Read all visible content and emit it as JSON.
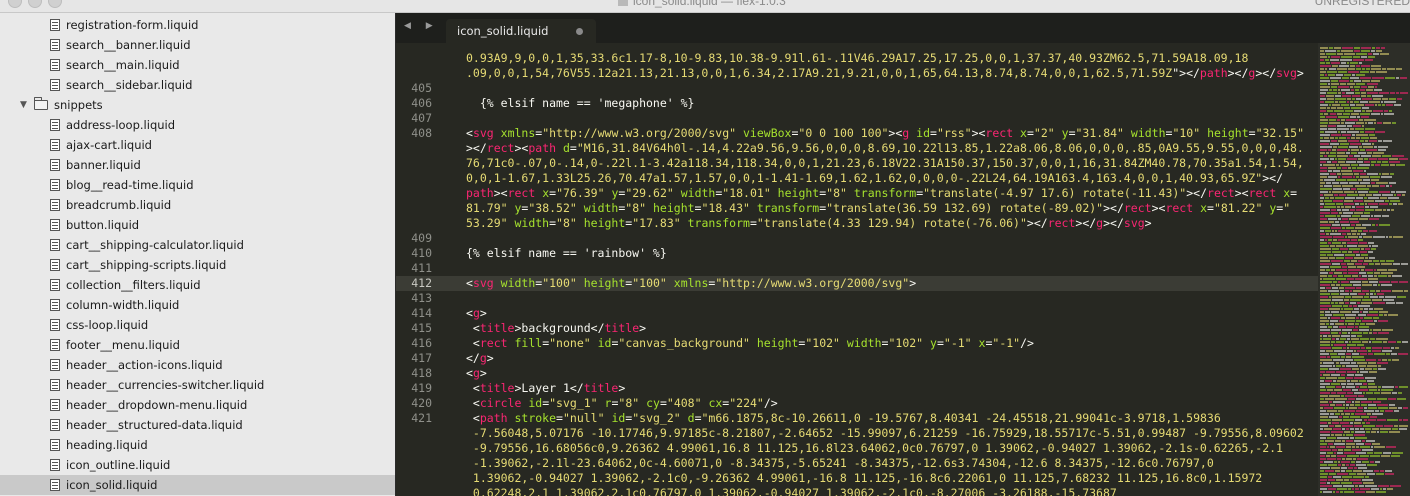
{
  "window": {
    "title": "icon_solid.liquid — flex-1.0.3",
    "license": "UNREGISTERED"
  },
  "sidebar": {
    "files_before": [
      "registration-form.liquid",
      "search__banner.liquid",
      "search__main.liquid",
      "search__sidebar.liquid"
    ],
    "folder": "snippets",
    "files": [
      "address-loop.liquid",
      "ajax-cart.liquid",
      "banner.liquid",
      "blog__read-time.liquid",
      "breadcrumb.liquid",
      "button.liquid",
      "cart__shipping-calculator.liquid",
      "cart__shipping-scripts.liquid",
      "collection__filters.liquid",
      "column-width.liquid",
      "css-loop.liquid",
      "footer__menu.liquid",
      "header__action-icons.liquid",
      "header__currencies-switcher.liquid",
      "header__dropdown-menu.liquid",
      "header__structured-data.liquid",
      "heading.liquid",
      "icon_outline.liquid",
      "icon_solid.liquid"
    ],
    "selected": "icon_solid.liquid"
  },
  "editor": {
    "tab_label": "icon_solid.liquid",
    "active_line": "412",
    "lines": [
      {
        "n": "",
        "segs": [
          [
            "s",
            "0.93A9,9,0,0,1,35,33.6c1.17-8,10-9.83,10.38-9.91l.61-.11V46.29A17.25,17.25,0,0,1,37.37,40.93ZM62.5,71.59A18.09,18"
          ]
        ]
      },
      {
        "n": "",
        "segs": [
          [
            "s",
            ".09,0,0,1,54,76V55.12a21.13,21.13,0,0,1,6.34,2.17A9.21,9.21,0,0,1,65,64.13,8.74,8.74,0,0,1,62.5,71.59Z"
          ],
          [
            "p",
            "\"></"
          ],
          [
            "t",
            "path"
          ],
          [
            "p",
            "></"
          ],
          [
            "t",
            "g"
          ],
          [
            "p",
            "></"
          ],
          [
            "t",
            "svg"
          ],
          [
            "p",
            ">"
          ]
        ]
      },
      {
        "n": "405",
        "segs": []
      },
      {
        "n": "406",
        "segs": [
          [
            "p",
            "  {% elsif name == 'megaphone' %}"
          ]
        ]
      },
      {
        "n": "407",
        "segs": []
      },
      {
        "n": "408",
        "segs": [
          [
            "p",
            "<"
          ],
          [
            "t",
            "svg"
          ],
          [
            "a",
            " xmlns"
          ],
          [
            "p",
            "="
          ],
          [
            "s",
            "\"http://www.w3.org/2000/svg\""
          ],
          [
            "a",
            " viewBox"
          ],
          [
            "p",
            "="
          ],
          [
            "s",
            "\"0 0 100 100\""
          ],
          [
            "p",
            "><"
          ],
          [
            "t",
            "g"
          ],
          [
            "a",
            " id"
          ],
          [
            "p",
            "="
          ],
          [
            "s",
            "\"rss\""
          ],
          [
            "p",
            "><"
          ],
          [
            "t",
            "rect"
          ],
          [
            "a",
            " x"
          ],
          [
            "p",
            "="
          ],
          [
            "s",
            "\"2\""
          ],
          [
            "a",
            " y"
          ],
          [
            "p",
            "="
          ],
          [
            "s",
            "\"31.84\""
          ],
          [
            "a",
            " width"
          ],
          [
            "p",
            "="
          ],
          [
            "s",
            "\"10\""
          ],
          [
            "a",
            " height"
          ],
          [
            "p",
            "="
          ],
          [
            "s",
            "\"32.15\""
          ]
        ]
      },
      {
        "n": "",
        "segs": [
          [
            "p",
            "></"
          ],
          [
            "t",
            "rect"
          ],
          [
            "p",
            "><"
          ],
          [
            "t",
            "path"
          ],
          [
            "a",
            " d"
          ],
          [
            "p",
            "="
          ],
          [
            "s",
            "\"M16,31.84V64h0l-.14,4.22a9.56,9.56,0,0,0,8.69,10.22l13.85,1.22a8.06,8.06,0,0,0,.85,0A9.55,9.55,0,0,0,48."
          ]
        ]
      },
      {
        "n": "",
        "segs": [
          [
            "s",
            "76,71c0-.07,0-.14,0-.22l.1-3.42a118.34,118.34,0,0,1,21.23,6.18V22.31A150.37,150.37,0,0,1,16,31.84ZM40.78,70.35a1.54,1.54,"
          ]
        ]
      },
      {
        "n": "",
        "segs": [
          [
            "s",
            "0,0,1-1.67,1.33L25.26,70.47a1.57,1.57,0,0,1-1.41-1.69,1.62,1.62,0,0,0,0-.22L24,64.19A163.4,163.4,0,0,1,40.93,65.9Z\""
          ],
          [
            "p",
            "></"
          ]
        ]
      },
      {
        "n": "",
        "segs": [
          [
            "t",
            "path"
          ],
          [
            "p",
            "><"
          ],
          [
            "t",
            "rect"
          ],
          [
            "a",
            " x"
          ],
          [
            "p",
            "="
          ],
          [
            "s",
            "\"76.39\""
          ],
          [
            "a",
            " y"
          ],
          [
            "p",
            "="
          ],
          [
            "s",
            "\"29.62\""
          ],
          [
            "a",
            " width"
          ],
          [
            "p",
            "="
          ],
          [
            "s",
            "\"18.01\""
          ],
          [
            "a",
            " height"
          ],
          [
            "p",
            "="
          ],
          [
            "s",
            "\"8\""
          ],
          [
            "a",
            " transform"
          ],
          [
            "p",
            "="
          ],
          [
            "s",
            "\"translate(-4.97 17.6) rotate(-11.43)\""
          ],
          [
            "p",
            "></"
          ],
          [
            "t",
            "rect"
          ],
          [
            "p",
            "><"
          ],
          [
            "t",
            "rect"
          ],
          [
            "a",
            " x"
          ],
          [
            "p",
            "="
          ]
        ]
      },
      {
        "n": "",
        "segs": [
          [
            "s",
            "81.79\""
          ],
          [
            "a",
            " y"
          ],
          [
            "p",
            "="
          ],
          [
            "s",
            "\"38.52\""
          ],
          [
            "a",
            " width"
          ],
          [
            "p",
            "="
          ],
          [
            "s",
            "\"8\""
          ],
          [
            "a",
            " height"
          ],
          [
            "p",
            "="
          ],
          [
            "s",
            "\"18.43\""
          ],
          [
            "a",
            " transform"
          ],
          [
            "p",
            "="
          ],
          [
            "s",
            "\"translate(36.59 132.69) rotate(-89.02)\""
          ],
          [
            "p",
            "></"
          ],
          [
            "t",
            "rect"
          ],
          [
            "p",
            "><"
          ],
          [
            "t",
            "rect"
          ],
          [
            "a",
            " x"
          ],
          [
            "p",
            "="
          ],
          [
            "s",
            "\"81.22\""
          ],
          [
            "a",
            " y"
          ],
          [
            "p",
            "="
          ],
          [
            "s",
            "\""
          ]
        ]
      },
      {
        "n": "",
        "segs": [
          [
            "s",
            "53.29\""
          ],
          [
            "a",
            " width"
          ],
          [
            "p",
            "="
          ],
          [
            "s",
            "\"8\""
          ],
          [
            "a",
            " height"
          ],
          [
            "p",
            "="
          ],
          [
            "s",
            "\"17.83\""
          ],
          [
            "a",
            " transform"
          ],
          [
            "p",
            "="
          ],
          [
            "s",
            "\"translate(4.33 129.94) rotate(-76.06)\""
          ],
          [
            "p",
            "></"
          ],
          [
            "t",
            "rect"
          ],
          [
            "p",
            "></"
          ],
          [
            "t",
            "g"
          ],
          [
            "p",
            "></"
          ],
          [
            "t",
            "svg"
          ],
          [
            "p",
            ">"
          ]
        ]
      },
      {
        "n": "409",
        "segs": []
      },
      {
        "n": "410",
        "segs": [
          [
            "p",
            "{% elsif name == 'rainbow' %}"
          ]
        ]
      },
      {
        "n": "411",
        "segs": []
      },
      {
        "n": "412",
        "segs": [
          [
            "p",
            "<"
          ],
          [
            "t",
            "svg"
          ],
          [
            "a",
            " width"
          ],
          [
            "p",
            "="
          ],
          [
            "s",
            "\"100\""
          ],
          [
            "a",
            " height"
          ],
          [
            "p",
            "="
          ],
          [
            "s",
            "\"100\""
          ],
          [
            "a",
            " xmlns"
          ],
          [
            "p",
            "="
          ],
          [
            "s",
            "\"http://www.w3.org/2000/svg\""
          ],
          [
            "p",
            ">"
          ]
        ]
      },
      {
        "n": "413",
        "segs": []
      },
      {
        "n": "414",
        "segs": [
          [
            "p",
            "<"
          ],
          [
            "t",
            "g"
          ],
          [
            "p",
            ">"
          ]
        ]
      },
      {
        "n": "415",
        "segs": [
          [
            "p",
            " <"
          ],
          [
            "t",
            "title"
          ],
          [
            "p",
            ">background</"
          ],
          [
            "t",
            "title"
          ],
          [
            "p",
            ">"
          ]
        ]
      },
      {
        "n": "416",
        "segs": [
          [
            "p",
            " <"
          ],
          [
            "t",
            "rect"
          ],
          [
            "a",
            " fill"
          ],
          [
            "p",
            "="
          ],
          [
            "s",
            "\"none\""
          ],
          [
            "a",
            " id"
          ],
          [
            "p",
            "="
          ],
          [
            "s",
            "\"canvas_background\""
          ],
          [
            "a",
            " height"
          ],
          [
            "p",
            "="
          ],
          [
            "s",
            "\"102\""
          ],
          [
            "a",
            " width"
          ],
          [
            "p",
            "="
          ],
          [
            "s",
            "\"102\""
          ],
          [
            "a",
            " y"
          ],
          [
            "p",
            "="
          ],
          [
            "s",
            "\"-1\""
          ],
          [
            "a",
            " x"
          ],
          [
            "p",
            "="
          ],
          [
            "s",
            "\"-1\""
          ],
          [
            "p",
            "/>"
          ]
        ]
      },
      {
        "n": "417",
        "segs": [
          [
            "p",
            "</"
          ],
          [
            "t",
            "g"
          ],
          [
            "p",
            ">"
          ]
        ]
      },
      {
        "n": "418",
        "segs": [
          [
            "p",
            "<"
          ],
          [
            "t",
            "g"
          ],
          [
            "p",
            ">"
          ]
        ]
      },
      {
        "n": "419",
        "segs": [
          [
            "p",
            " <"
          ],
          [
            "t",
            "title"
          ],
          [
            "p",
            ">Layer 1</"
          ],
          [
            "t",
            "title"
          ],
          [
            "p",
            ">"
          ]
        ]
      },
      {
        "n": "420",
        "segs": [
          [
            "p",
            " <"
          ],
          [
            "t",
            "circle"
          ],
          [
            "a",
            " id"
          ],
          [
            "p",
            "="
          ],
          [
            "s",
            "\"svg_1\""
          ],
          [
            "a",
            " r"
          ],
          [
            "p",
            "="
          ],
          [
            "s",
            "\"8\""
          ],
          [
            "a",
            " cy"
          ],
          [
            "p",
            "="
          ],
          [
            "s",
            "\"408\""
          ],
          [
            "a",
            " cx"
          ],
          [
            "p",
            "="
          ],
          [
            "s",
            "\"224\""
          ],
          [
            "p",
            "/>"
          ]
        ]
      },
      {
        "n": "421",
        "segs": [
          [
            "p",
            " <"
          ],
          [
            "t",
            "path"
          ],
          [
            "a",
            " stroke"
          ],
          [
            "p",
            "="
          ],
          [
            "s",
            "\"null\""
          ],
          [
            "a",
            " id"
          ],
          [
            "p",
            "="
          ],
          [
            "s",
            "\"svg_2\""
          ],
          [
            "a",
            " d"
          ],
          [
            "p",
            "="
          ],
          [
            "s",
            "\"m66.1875,8c-10.26611,0 -19.5767,8.40341 -24.45518,21.99041c-3.9718,1.59836"
          ]
        ]
      },
      {
        "n": "",
        "segs": [
          [
            "s",
            " -7.56048,5.07176 -10.17746,9.97185c-8.21807,-2.64652 -15.99097,6.21259 -16.75929,18.55717c-5.51,0.99487 -9.79556,8.09602"
          ]
        ]
      },
      {
        "n": "",
        "segs": [
          [
            "s",
            " -9.79556,16.68056c0,9.26362 4.99061,16.8 11.125,16.8l23.64062,0c0.76797,0 1.39062,-0.94027 1.39062,-2.1s-0.62265,-2.1"
          ]
        ]
      },
      {
        "n": "",
        "segs": [
          [
            "s",
            " -1.39062,-2.1l-23.64062,0c-4.60071,0 -8.34375,-5.65241 -8.34375,-12.6s3.74304,-12.6 8.34375,-12.6c0.76797,0"
          ]
        ]
      },
      {
        "n": "",
        "segs": [
          [
            "s",
            " 1.39062,-0.94027 1.39062,-2.1c0,-9.26362 4.99061,-16.8 11.125,-16.8c6.22061,0 11.125,7.68232 11.125,16.8c0,1.15972"
          ]
        ]
      },
      {
        "n": "",
        "segs": [
          [
            "s",
            " 0.62248,2.1 1.39062,2.1c0.76797,0 1.39062,-0.94027 1.39062,-2.1c0,-8.27006 -3.26188,-15.73687"
          ]
        ]
      }
    ]
  },
  "colors": {
    "background": "#272822",
    "tag": "#f92672",
    "attribute": "#a6e22e",
    "string": "#e6db74",
    "text": "#f8f8f2",
    "line_number": "#8f908a",
    "sidebar": "#e9e9e9"
  }
}
